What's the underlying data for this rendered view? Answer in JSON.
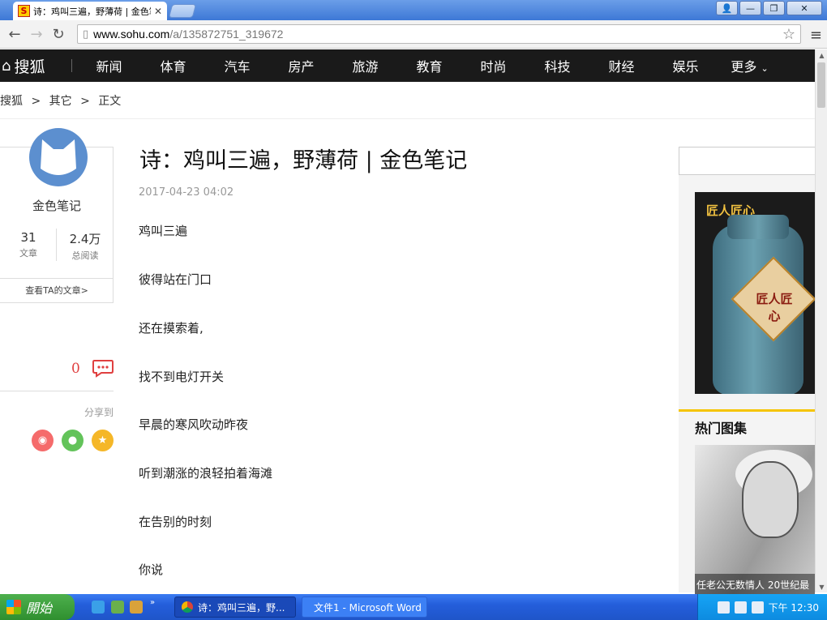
{
  "browser": {
    "tab_title": "诗：鸡叫三遍，野薄荷 | 金色笔记",
    "url_host": "www.sohu.com",
    "url_path": "/a/135872751_319672"
  },
  "site": {
    "logo_text": "搜狐",
    "nav": [
      "新闻",
      "体育",
      "汽车",
      "房产",
      "旅游",
      "教育",
      "时尚",
      "科技",
      "财经",
      "娱乐",
      "更多"
    ]
  },
  "breadcrumb": [
    "搜狐",
    ">",
    "其它",
    ">",
    "正文"
  ],
  "author": {
    "name": "金色笔记",
    "articles_count": "31",
    "articles_label": "文章",
    "reads_count": "2.4万",
    "reads_label": "总阅读",
    "more_link": "查看TA的文章>"
  },
  "side": {
    "comment_count": "0",
    "share_label": "分享到"
  },
  "article": {
    "title": "诗：鸡叫三遍，野薄荷 | 金色笔记",
    "date": "2017-04-23 04:02",
    "paragraphs": [
      "鸡叫三遍",
      "彼得站在门口",
      "还在摸索着,",
      "找不到电灯开关",
      "早晨的寒风吹动昨夜",
      "听到潮涨的浪轻拍着海滩",
      "在告别的时刻",
      "你说"
    ]
  },
  "right": {
    "ad_text": "匠人匠心",
    "jar_label": "匠人匠心",
    "hot_gallery_title": "热门图集",
    "hot_gallery_caption": "任老公无数情人 20世纪最"
  },
  "taskbar": {
    "start_label": "開始",
    "items": [
      "诗：鸡叫三遍，野...",
      "文件1 - Microsoft Word"
    ],
    "clock": "下午 12:30"
  }
}
